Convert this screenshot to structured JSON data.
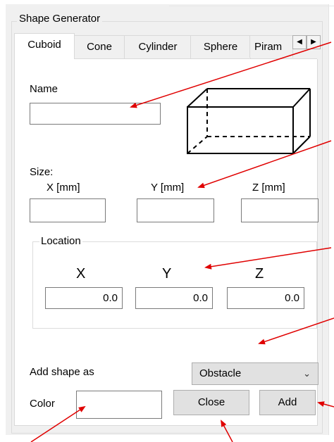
{
  "group_title": "Shape Generator",
  "tabs": [
    {
      "label": "Cuboid",
      "active": true
    },
    {
      "label": "Cone",
      "active": false
    },
    {
      "label": "Cylinder",
      "active": false
    },
    {
      "label": "Sphere",
      "active": false
    },
    {
      "label": "Piram",
      "active": false
    }
  ],
  "tab_scroll": {
    "left_glyph": "◀",
    "right_glyph": "▶"
  },
  "name": {
    "label": "Name",
    "value": ""
  },
  "size": {
    "label": "Size:",
    "x_label": "X [mm]",
    "y_label": "Y [mm]",
    "z_label": "Z [mm]",
    "x_value": "",
    "y_value": "",
    "z_value": ""
  },
  "location": {
    "legend": "Location",
    "x_label": "X",
    "y_label": "Y",
    "z_label": "Z",
    "x_value": "0.0",
    "y_value": "0.0",
    "z_value": "0.0"
  },
  "add_shape": {
    "label": "Add shape as",
    "selected": "Obstacle"
  },
  "color": {
    "label": "Color"
  },
  "buttons": {
    "close": "Close",
    "add": "Add"
  },
  "colors": {
    "arrow": "#e00000",
    "panel": "#f0f0f0",
    "button": "#e1e1e1"
  }
}
